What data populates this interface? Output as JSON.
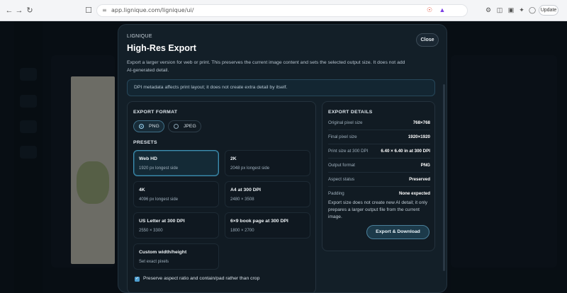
{
  "browser": {
    "url": "app.lignique.com/lignique/ui/",
    "update_label": "Update"
  },
  "modal": {
    "brand": "LIGNIQUE",
    "title": "High-Res Export",
    "description": "Export a larger version for web or print. This preserves the current image content and sets the selected output size. It does not add AI-generated detail.",
    "close_label": "Close",
    "notice": "DPI metadata affects print layout; it does not create extra detail by itself."
  },
  "export_format": {
    "title": "EXPORT FORMAT",
    "options": [
      {
        "label": "PNG",
        "selected": true
      },
      {
        "label": "JPEG",
        "selected": false
      }
    ]
  },
  "presets": {
    "title": "PRESETS",
    "items": [
      {
        "title": "Web HD",
        "subtitle": "1920 px longest side",
        "selected": true
      },
      {
        "title": "2K",
        "subtitle": "2048 px longest side",
        "selected": false
      },
      {
        "title": "4K",
        "subtitle": "4096 px longest side",
        "selected": false
      },
      {
        "title": "A4 at 300 DPI",
        "subtitle": "2480 × 3508",
        "selected": false
      },
      {
        "title": "US Letter at 300 DPI",
        "subtitle": "2550 × 3300",
        "selected": false
      },
      {
        "title": "6×9 book page at 300 DPI",
        "subtitle": "1800 × 2700",
        "selected": false
      },
      {
        "title": "Custom width/height",
        "subtitle": "Set exact pixels",
        "selected": false
      }
    ]
  },
  "preserve_aspect": {
    "label": "Preserve aspect ratio and contain/pad rather than crop",
    "checked": true
  },
  "details": {
    "title": "EXPORT DETAILS",
    "rows": [
      {
        "label": "Original pixel size",
        "value": "768×768"
      },
      {
        "label": "Final pixel size",
        "value": "1920×1920"
      },
      {
        "label": "Print size at 300 DPI",
        "value": "6.40 × 6.40 in at 300 DPI"
      },
      {
        "label": "Output format",
        "value": "PNG"
      },
      {
        "label": "Aspect status",
        "value": "Preserved"
      },
      {
        "label": "Padding",
        "value": "None expected"
      }
    ],
    "note": "Export size does not create new AI detail; it only prepares a larger output file from the current image.",
    "export_label": "Export & Download"
  },
  "colors": {
    "accent": "#4e9fd0",
    "modal_bg": "#131f28"
  }
}
